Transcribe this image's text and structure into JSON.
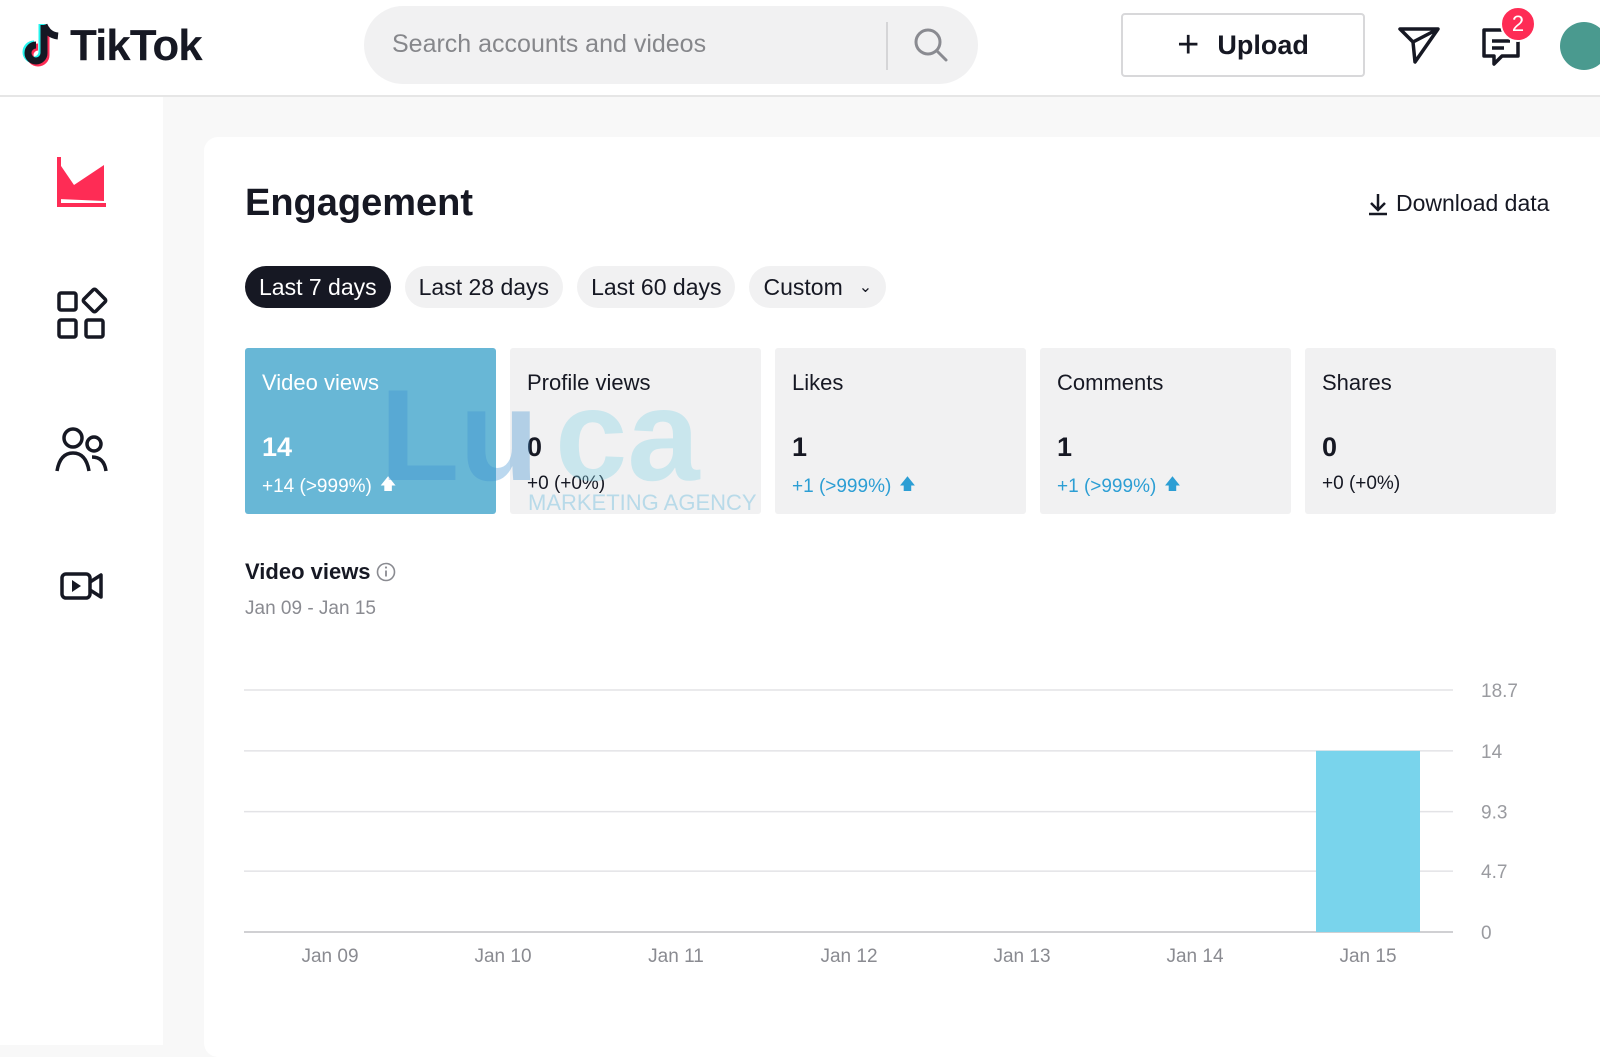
{
  "header": {
    "logo_text": "TikTok",
    "search_placeholder": "Search accounts and videos",
    "upload_label": "Upload",
    "inbox_badge": "2"
  },
  "sidebar": {
    "items": [
      {
        "name": "analytics",
        "icon": "chart-area-icon",
        "active": true
      },
      {
        "name": "content",
        "icon": "grid-shapes-icon",
        "active": false
      },
      {
        "name": "followers",
        "icon": "users-icon",
        "active": false
      },
      {
        "name": "live",
        "icon": "video-camera-icon",
        "active": false
      }
    ]
  },
  "main": {
    "title": "Engagement",
    "download_label": "Download data",
    "filters": [
      {
        "label": "Last 7 days",
        "active": true
      },
      {
        "label": "Last 28 days",
        "active": false
      },
      {
        "label": "Last 60 days",
        "active": false
      },
      {
        "label": "Custom",
        "active": false
      }
    ],
    "metrics": [
      {
        "label": "Video views",
        "value": "14",
        "change": "+14 (>999%)",
        "trend": "up",
        "active": true
      },
      {
        "label": "Profile views",
        "value": "0",
        "change": "+0 (+0%)",
        "trend": "none",
        "active": false
      },
      {
        "label": "Likes",
        "value": "1",
        "change": "+1 (>999%)",
        "trend": "up",
        "active": false
      },
      {
        "label": "Comments",
        "value": "1",
        "change": "+1 (>999%)",
        "trend": "up",
        "active": false
      },
      {
        "label": "Shares",
        "value": "0",
        "change": "+0 (+0%)",
        "trend": "none",
        "active": false
      }
    ],
    "watermark": "Luca MARKETING AGENCY",
    "chart_title": "Video views",
    "chart_range": "Jan 09 - Jan 15"
  },
  "colors": {
    "accent": "#fe2c55",
    "active_metric": "#68b7d6",
    "bar": "#79d4ec",
    "trend_up": "#2c9ed4"
  },
  "chart_data": {
    "type": "bar",
    "categories": [
      "Jan 09",
      "Jan 10",
      "Jan 11",
      "Jan 12",
      "Jan 13",
      "Jan 14",
      "Jan 15"
    ],
    "values": [
      0,
      0,
      0,
      0,
      0,
      0,
      14
    ],
    "title": "Video views",
    "subtitle": "Jan 09 - Jan 15",
    "yticks": [
      "0",
      "4.7",
      "9.3",
      "14",
      "18.7"
    ],
    "ytick_values": [
      0,
      4.7,
      9.3,
      14,
      18.7
    ],
    "ylim": [
      0,
      18.7
    ],
    "grid": true,
    "y_axis_side": "right"
  }
}
